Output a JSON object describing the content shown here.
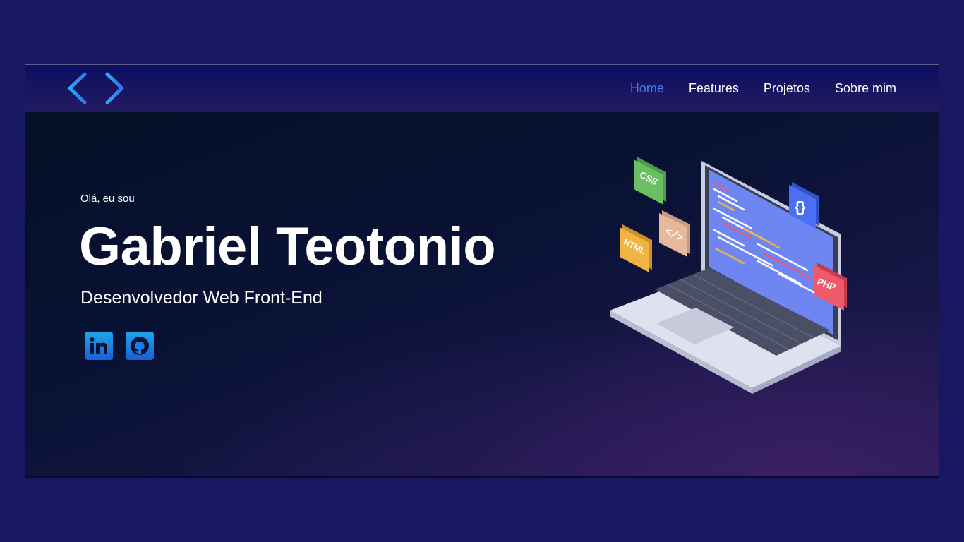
{
  "nav": {
    "logo_icon": "code-brackets-icon",
    "items": [
      {
        "label": "Home",
        "active": true
      },
      {
        "label": "Features",
        "active": false
      },
      {
        "label": "Projetos",
        "active": false
      },
      {
        "label": "Sobre mim",
        "active": false
      }
    ]
  },
  "hero": {
    "greeting": "Olá, eu sou",
    "name": "Gabriel Teotonio",
    "role": "Desenvolvedor Web Front-End",
    "social": [
      {
        "icon": "linkedin-icon"
      },
      {
        "icon": "github-icon"
      }
    ],
    "badges": {
      "css": "CSS",
      "html": "HTML",
      "tag": "</>",
      "braces": "{}",
      "php": "PHP"
    }
  },
  "colors": {
    "page_background": "#171762",
    "accent": "#3f7df0",
    "text": "#ffffff"
  }
}
